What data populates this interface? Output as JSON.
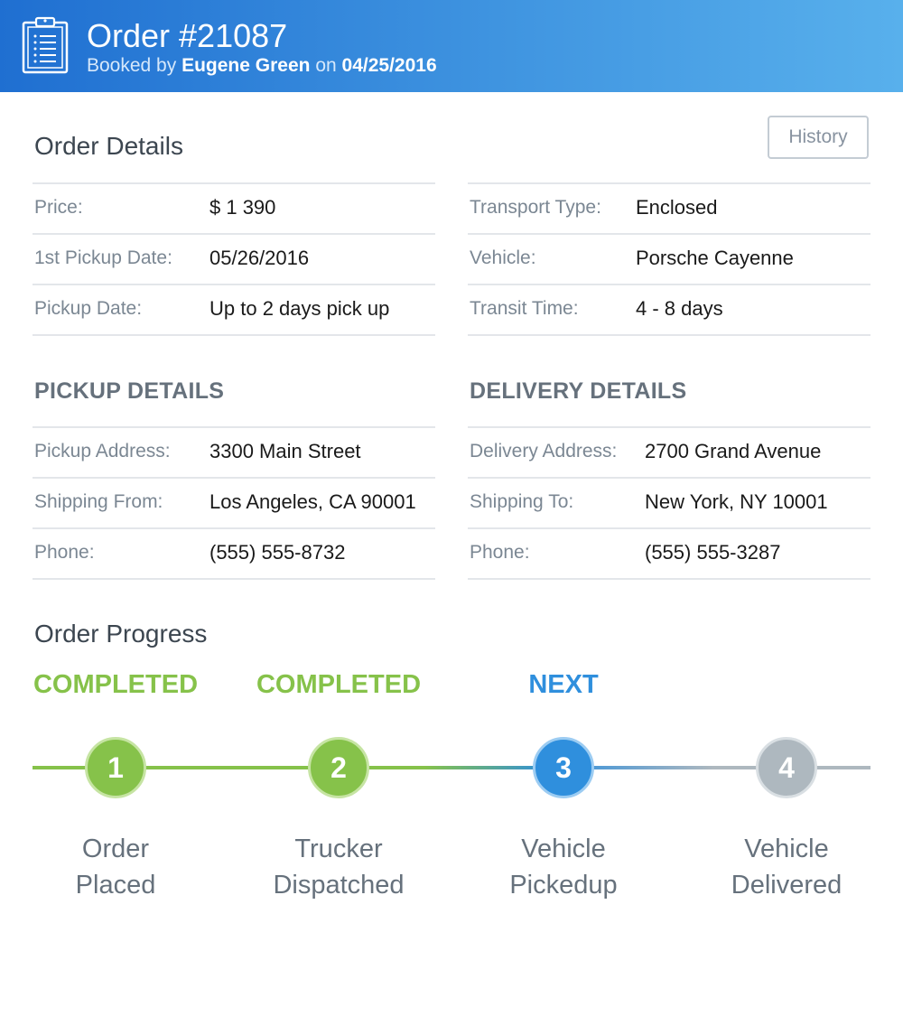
{
  "header": {
    "title": "Order #21087",
    "booked_prefix": "Booked by",
    "booked_by": "Eugene Green",
    "on_word": "on",
    "booked_date": "04/25/2016",
    "icon": "clipboard-icon"
  },
  "order_details": {
    "title": "Order Details",
    "history_label": "History",
    "left": [
      {
        "label": "Price:",
        "value": "$ 1 390"
      },
      {
        "label": "1st Pickup Date:",
        "value": "05/26/2016"
      },
      {
        "label": "Pickup Date:",
        "value": "Up to 2 days pick up"
      }
    ],
    "right": [
      {
        "label": "Transport Type:",
        "value": "Enclosed"
      },
      {
        "label": "Vehicle:",
        "value": "Porsche Cayenne"
      },
      {
        "label": "Transit Time:",
        "value": "4 - 8 days"
      }
    ]
  },
  "pickup": {
    "title": "PICKUP DETAILS",
    "rows": [
      {
        "label": "Pickup Address:",
        "value": "3300 Main Street"
      },
      {
        "label": "Shipping From:",
        "value": "Los Angeles, CA 90001"
      },
      {
        "label": "Phone:",
        "value": "(555) 555-8732"
      }
    ]
  },
  "delivery": {
    "title": "DELIVERY DETAILS",
    "rows": [
      {
        "label": "Delivery Address:",
        "value": "2700 Grand Avenue"
      },
      {
        "label": "Shipping To:",
        "value": "New York, NY 10001"
      },
      {
        "label": "Phone:",
        "value": "(555) 555-3287"
      }
    ]
  },
  "progress": {
    "title": "Order Progress",
    "steps": [
      {
        "number": "1",
        "status": "COMPLETED",
        "label_line1": "Order",
        "label_line2": "Placed"
      },
      {
        "number": "2",
        "status": "COMPLETED",
        "label_line1": "Trucker",
        "label_line2": "Dispatched"
      },
      {
        "number": "3",
        "status": "NEXT",
        "label_line1": "Vehicle",
        "label_line2": "Pickedup"
      },
      {
        "number": "4",
        "status": "",
        "label_line1": "Vehicle",
        "label_line2": "Delivered"
      }
    ]
  },
  "colors": {
    "header_start": "#1f6fd1",
    "header_end": "#58b0ec",
    "completed": "#86c24a",
    "current": "#2f8fdd",
    "pending": "#aeb8bf"
  }
}
